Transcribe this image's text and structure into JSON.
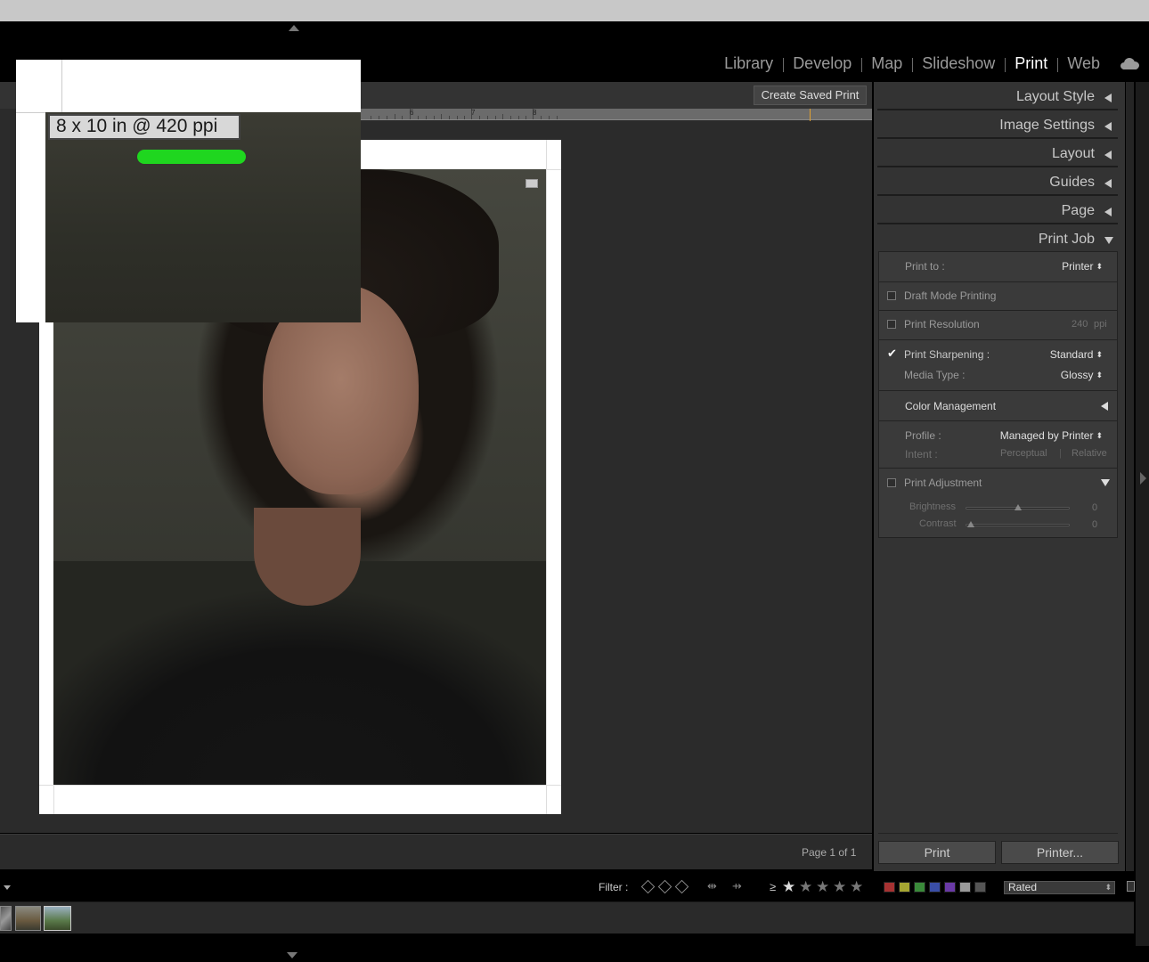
{
  "modules": [
    "Library",
    "Develop",
    "Map",
    "Slideshow",
    "Print",
    "Web"
  ],
  "active_module": "Print",
  "toolbar": {
    "create_saved_print": "Create Saved Print"
  },
  "ruler": {
    "labels": [
      "6",
      "7",
      "8"
    ]
  },
  "loupe": {
    "size_label": "8 x 10 in @ 420 ppi"
  },
  "status": {
    "page_info": "Page 1 of 1"
  },
  "panels": {
    "layout_style": "Layout Style",
    "image_settings": "Image Settings",
    "layout": "Layout",
    "guides": "Guides",
    "page": "Page",
    "print_job": "Print Job"
  },
  "print_job": {
    "print_to_label": "Print to :",
    "print_to_value": "Printer",
    "draft_mode": {
      "label": "Draft Mode Printing",
      "checked": false
    },
    "print_resolution": {
      "label": "Print Resolution",
      "value": "240",
      "unit": "ppi",
      "checked": false
    },
    "print_sharpening": {
      "label": "Print Sharpening :",
      "value": "Standard",
      "checked": true
    },
    "media_type": {
      "label": "Media Type :",
      "value": "Glossy"
    },
    "color_management": "Color Management",
    "profile": {
      "label": "Profile :",
      "value": "Managed by Printer"
    },
    "intent": {
      "label": "Intent :",
      "option1": "Perceptual",
      "separator": "|",
      "option2": "Relative"
    },
    "print_adjustment": {
      "label": "Print Adjustment",
      "checked": false
    },
    "brightness": {
      "label": "Brightness",
      "value": "0",
      "position": 0.5
    },
    "contrast": {
      "label": "Contrast",
      "value": "0",
      "position": 0.0
    }
  },
  "buttons": {
    "print": "Print",
    "printer": "Printer..."
  },
  "filter_bar": {
    "label": "Filter :",
    "rating_operator": "≥",
    "rating": 1,
    "max_rating": 5,
    "rating_filter_value": "Rated",
    "color_labels": [
      "#a63232",
      "#a6a632",
      "#3a8a3a",
      "#3a4ea6",
      "#6a3aa6",
      "#9a9a9a",
      "#555555"
    ]
  },
  "icons": {
    "cloud": "cloud-icon",
    "flag": "flag-icon",
    "lock": "lock-icon",
    "checkmark": "checkmark-icon"
  }
}
